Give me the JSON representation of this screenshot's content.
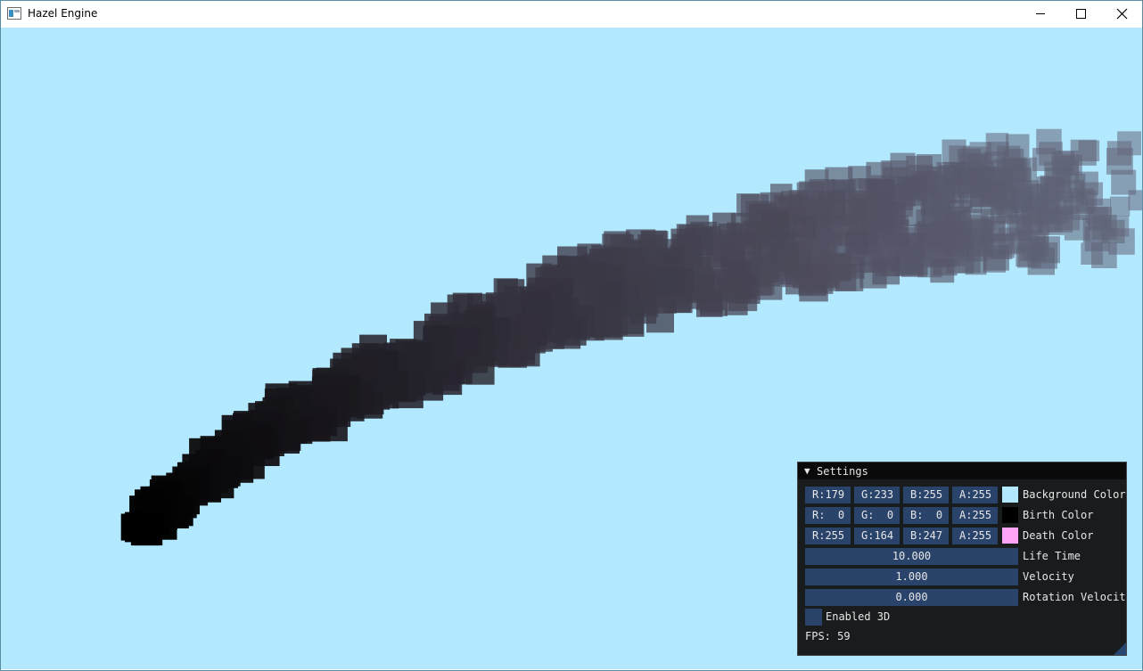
{
  "window": {
    "title": "Hazel Engine",
    "icons": {
      "app": "app-window-icon",
      "minimize": "minimize-icon",
      "maximize": "maximize-icon",
      "close": "close-icon"
    }
  },
  "scene": {
    "background_color": "#b3e9ff",
    "birth_color": "#000000",
    "death_color": "#ffa4f7"
  },
  "settings": {
    "title": "Settings",
    "collapse_glyph": "▼",
    "rows": [
      {
        "r": "R:179",
        "g": "G:233",
        "b": "B:255",
        "a": "A:255",
        "swatch": "#b3e9ff",
        "label": "Background Color"
      },
      {
        "r": "R:  0",
        "g": "G:  0",
        "b": "B:  0",
        "a": "A:255",
        "swatch": "#000000",
        "label": "Birth Color"
      },
      {
        "r": "R:255",
        "g": "G:164",
        "b": "B:247",
        "a": "A:255",
        "swatch": "#ffa4f7",
        "label": "Death Color"
      }
    ],
    "life_time": {
      "value": "10.000",
      "label": "Life Time"
    },
    "velocity": {
      "value": "1.000",
      "label": "Velocity"
    },
    "rotation_velocity": {
      "value": "0.000",
      "label": "Rotation Velocity"
    },
    "enabled_3d": {
      "label": "Enabled 3D",
      "checked": false
    },
    "fps": "FPS: 59"
  }
}
